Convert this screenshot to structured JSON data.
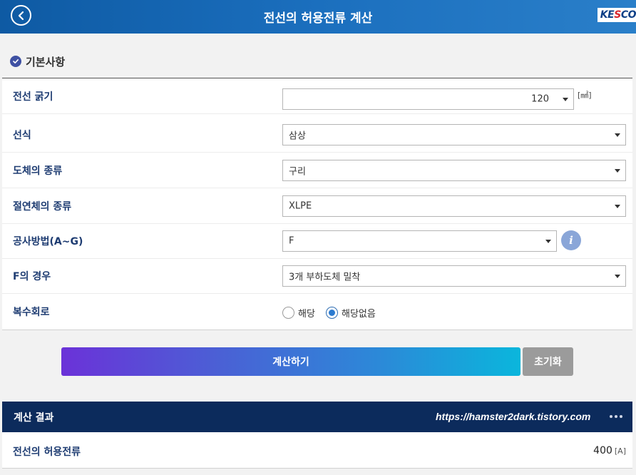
{
  "header": {
    "title": "전선의 허용전류 계산",
    "logo_text_1": "KE",
    "logo_text_2": "S",
    "logo_text_3": "CO"
  },
  "section": {
    "title": "기본사항"
  },
  "form": {
    "wire_size": {
      "label": "전선 굵기",
      "value": "120",
      "unit": "[㎟]"
    },
    "line_type": {
      "label": "선식",
      "value": "삼상"
    },
    "conductor": {
      "label": "도체의 종류",
      "value": "구리"
    },
    "insulation": {
      "label": "절연체의 종류",
      "value": "XLPE"
    },
    "method": {
      "label": "공사방법(A~G)",
      "value": "F",
      "info": "i"
    },
    "f_case": {
      "label": "F의 경우",
      "value": "3개 부하도체 밀착"
    },
    "multi_circuit": {
      "label": "복수회로",
      "option_yes": "해당",
      "option_no": "해당없음",
      "selected": "해당없음"
    }
  },
  "buttons": {
    "calculate": "계산하기",
    "reset": "초기화"
  },
  "result": {
    "title": "계산 결과",
    "watermark": "https://hamster2dark.tistory.com",
    "allowable_current": {
      "label": "전선의 허용전류",
      "value": "400",
      "unit": "[A]"
    }
  },
  "colors": {
    "header": "#1b6fbe",
    "result_header": "#0c2b5c",
    "label": "#1e3c72",
    "radio_accent": "#2c7bd0"
  },
  "icons": {
    "back": "back-arrow-icon",
    "check": "check-circle-icon",
    "info": "info-icon",
    "more": "more-dots-icon"
  }
}
